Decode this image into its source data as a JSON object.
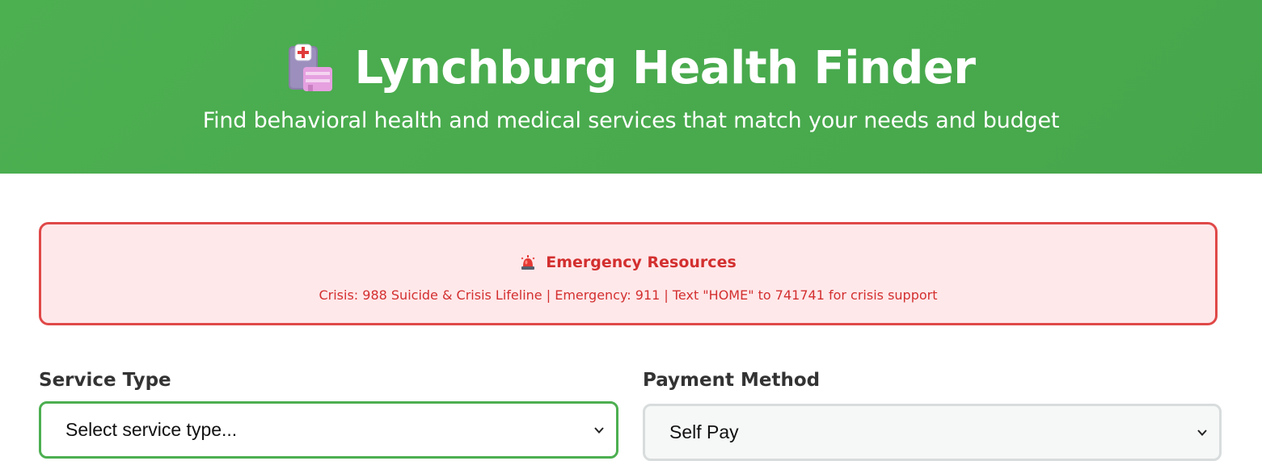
{
  "header": {
    "title": "Lynchburg Health Finder",
    "subtitle": "Find behavioral health and medical services that match your needs and budget",
    "icon": "hospital-icon",
    "background_color": "#4caf50"
  },
  "emergency": {
    "icon": "siren-icon",
    "title": "Emergency Resources",
    "text": "Crisis: 988 Suicide & Crisis Lifeline | Emergency: 911 | Text \"HOME\" to 741741 for crisis support",
    "text_color": "#d32f2f",
    "background_color": "#ffe8ea",
    "border_color": "#e04848"
  },
  "filters": {
    "service_type": {
      "label": "Service Type",
      "selected": "Select service type..."
    },
    "payment_method": {
      "label": "Payment Method",
      "selected": "Self Pay"
    }
  }
}
